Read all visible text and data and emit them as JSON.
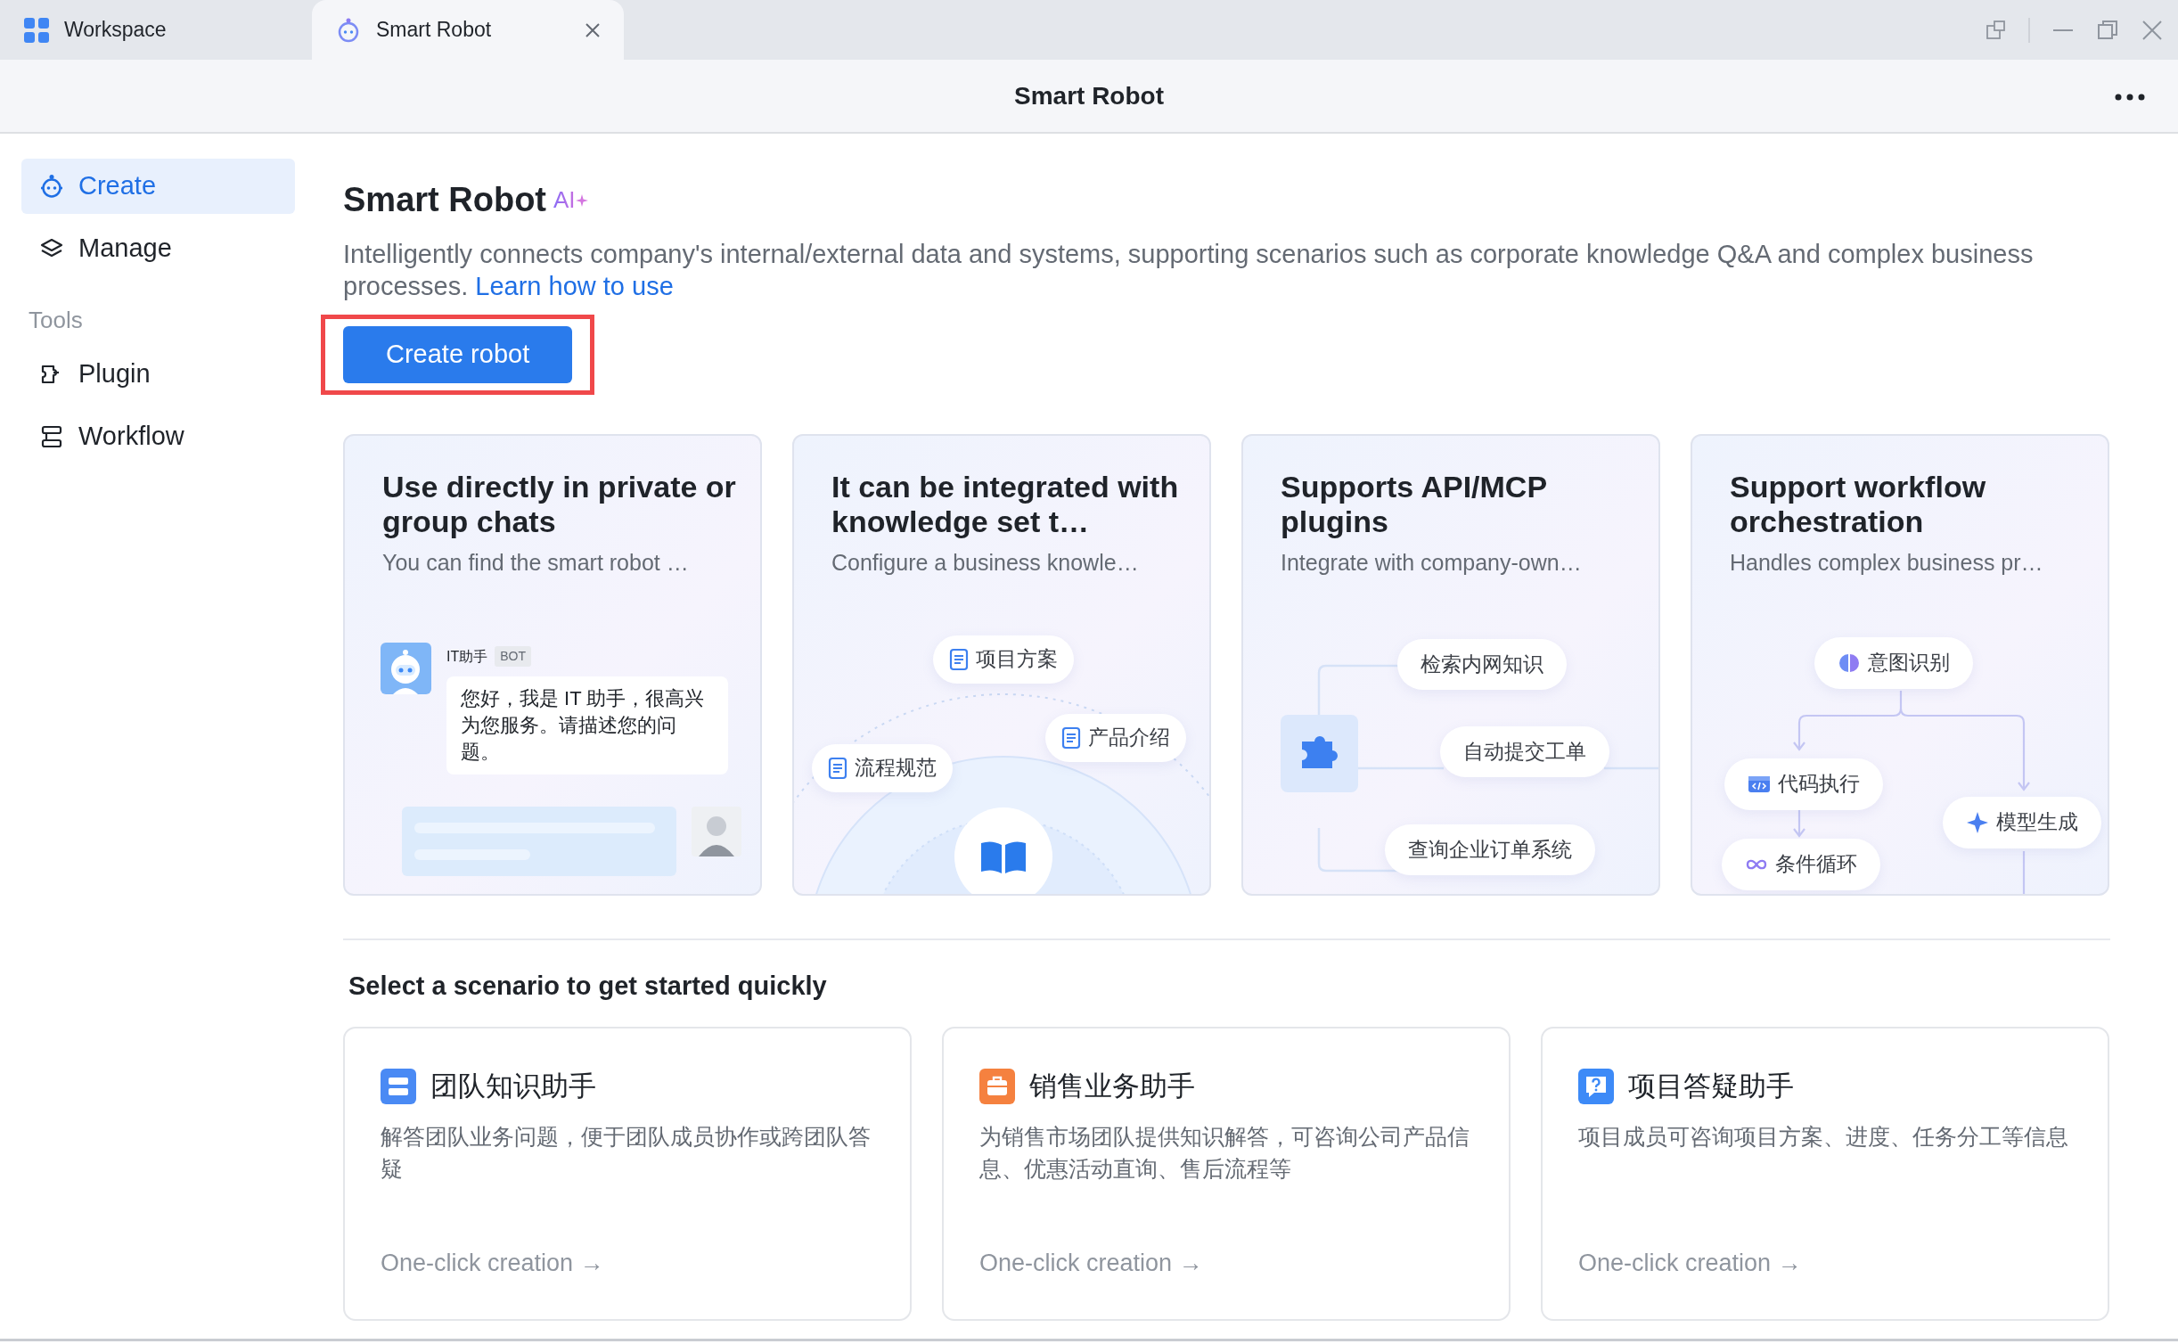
{
  "tabs": [
    {
      "label": "Workspace",
      "selected": false,
      "closable": false
    },
    {
      "label": "Smart Robot",
      "selected": true,
      "closable": true
    }
  ],
  "header": {
    "title": "Smart Robot"
  },
  "sidebar": {
    "items": [
      {
        "label": "Create",
        "selected": true
      },
      {
        "label": "Manage",
        "selected": false
      }
    ],
    "sections": [
      {
        "title": "Tools",
        "items": [
          {
            "label": "Plugin",
            "selected": false
          },
          {
            "label": "Workflow",
            "selected": false
          }
        ]
      }
    ]
  },
  "intro": {
    "title": "Smart Robot",
    "ai_badge": "AI",
    "description": "Intelligently connects company's internal/external data and systems, supporting scenarios such as corporate knowledge Q&A and complex business processes.",
    "link": "Learn how to use",
    "button": {
      "label": "Create robot",
      "highlighted": true
    }
  },
  "features": [
    {
      "kind": "chat",
      "title": "Use directly in private or group chats",
      "subtitle": "You can find the smart robot …",
      "bot_name": "IT助手",
      "bot_badge": "BOT",
      "message": "您好，我是 IT 助手，很高兴为您服务。请描述您的问题。"
    },
    {
      "kind": "knowledge",
      "title": "It can be integrated with knowledge set t…",
      "subtitle": "Configure a business knowle…",
      "docs": [
        "项目方案",
        "产品介绍",
        "流程规范"
      ]
    },
    {
      "kind": "plugins",
      "title": "Supports API/MCP plugins",
      "subtitle": "Integrate with company-own…",
      "actions": [
        "检索内网知识",
        "自动提交工单",
        "查询企业订单系统"
      ]
    },
    {
      "kind": "workflow",
      "title": "Support workflow orchestration",
      "subtitle": "Handles complex business pr…",
      "nodes": [
        "意图识别",
        "代码执行",
        "模型生成",
        "条件循环"
      ]
    }
  ],
  "scenarios": {
    "title": "Select a scenario to get started quickly",
    "items": [
      {
        "title": "团队知识助手",
        "color": "#4a8af4",
        "description": "解答团队业务问题，便于团队成员协作或跨团队答疑",
        "action": "One-click creation →"
      },
      {
        "title": "销售业务助手",
        "color": "#f5813f",
        "description": "为销售市场团队提供知识解答，可咨询公司产品信息、优惠活动直询、售后流程等",
        "action": "One-click creation →"
      },
      {
        "title": "项目答疑助手",
        "color": "#3d8af7",
        "description": "项目成员可咨询项目方案、进度、任务分工等信息",
        "action": "One-click creation →"
      }
    ]
  }
}
